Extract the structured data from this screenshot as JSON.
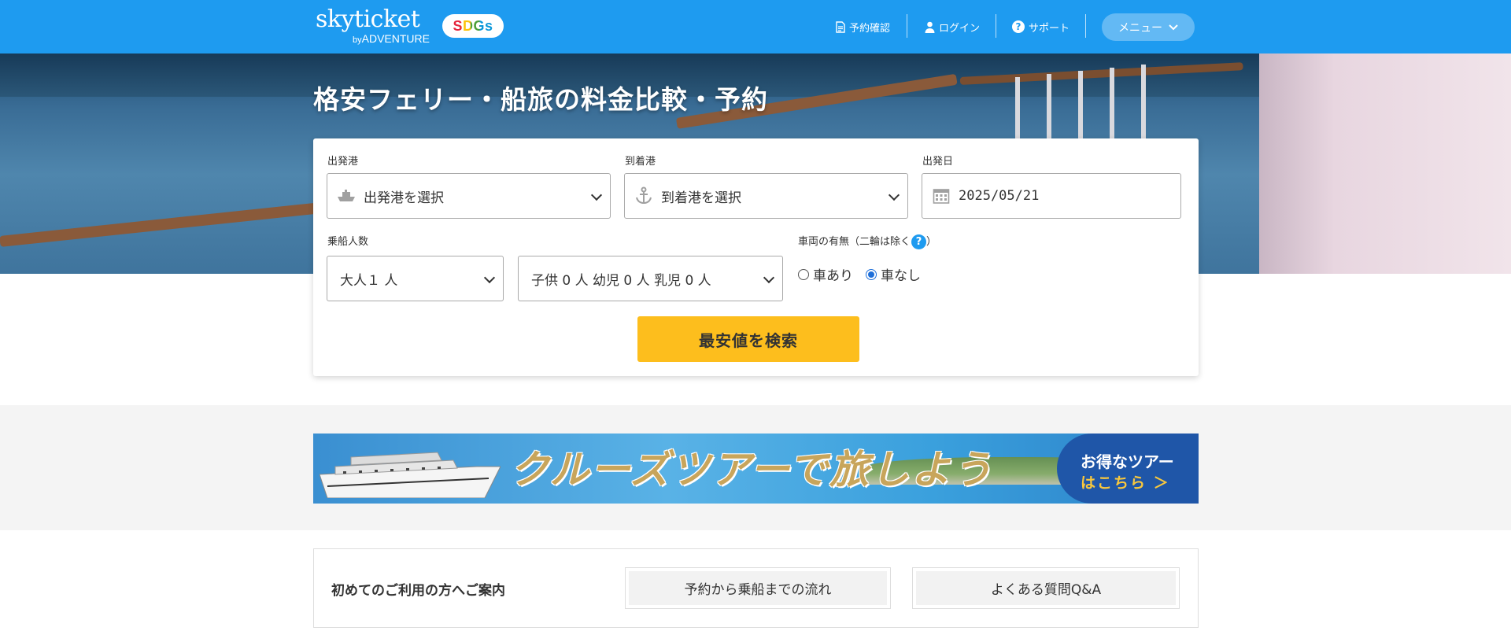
{
  "header": {
    "logo_main": "skyticket",
    "logo_by": "by",
    "logo_sub": "ADVENTURE",
    "sdgs": "SDGs",
    "nav": {
      "reservation": "予約確認",
      "login": "ログイン",
      "support": "サポート",
      "menu": "メニュー"
    }
  },
  "hero": {
    "title": "格安フェリー・船旅の料金比較・予約"
  },
  "search": {
    "departure_label": "出発港",
    "departure_value": "出発港を選択",
    "arrival_label": "到着港",
    "arrival_value": "到着港を選択",
    "date_label": "出発日",
    "date_value": "2025/05/21",
    "passengers_label": "乗船人数",
    "adults_value": "大人１ 人",
    "children_value": "子供 0 人 幼児 0 人 乳児 0 人",
    "vehicle_label": "車両の有無（二輪は除く",
    "vehicle_label_end": "）",
    "help": "?",
    "with_car": "車あり",
    "without_car": "車なし",
    "search_button": "最安値を検索"
  },
  "banner": {
    "text": "クルーズツアーで旅しよう",
    "cta_line1": "お得なツアー",
    "cta_line2": "はこちら ＞"
  },
  "guide": {
    "title": "初めてのご利用の方へご案内",
    "flow_button": "予約から乗船までの流れ",
    "faq_button": "よくある質問Q&A"
  },
  "colors": {
    "header_bg": "#1e9bf0",
    "search_button": "#fdbe1d",
    "radio_selected": "#1e6fd9"
  }
}
